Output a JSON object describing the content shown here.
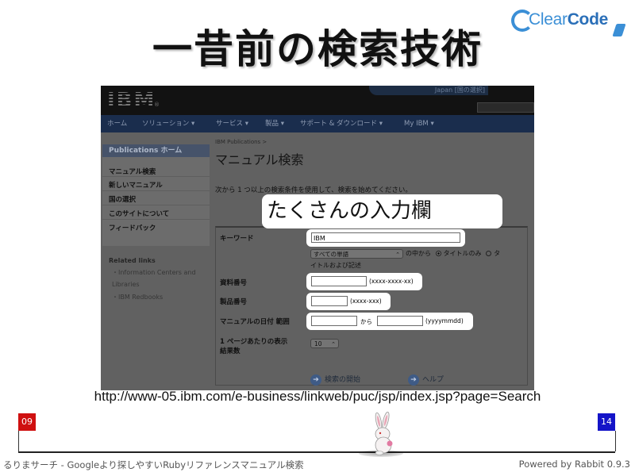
{
  "slide": {
    "title": "一昔前の検索技術",
    "callout": "たくさんの入力欄",
    "url": "http://www-05.ibm.com/e-business/linkweb/puc/jsp/index.jsp?page=Search"
  },
  "logo": {
    "prefix": "Clear",
    "suffix": "Code",
    "color": "#3b8fd6"
  },
  "screenshot": {
    "brand": "IBM",
    "region": "Japan [国の選択]",
    "nav": [
      "ホーム",
      "ソリューション ▾",
      "サービス ▾",
      "製品 ▾",
      "サポート & ダウンロード ▾",
      "My IBM ▾"
    ],
    "left_nav": {
      "header": "Publications ホーム",
      "items": [
        "マニュアル検索",
        "新しいマニュアル",
        "国の選択",
        "このサイトについて",
        "フィードバック"
      ]
    },
    "related": {
      "title": "Related links",
      "items": [
        "Information Centers and Libraries",
        "IBM Redbooks"
      ]
    },
    "breadcrumb": "IBM Publications >",
    "page_title": "マニュアル検索",
    "intro": "次から 1 つ以上の検索条件を使用して、検索を始めてください。",
    "form": {
      "keyword_label": "キーワード",
      "keyword_value": "IBM",
      "match_select": "すべての単語",
      "scope_label": "の中から",
      "scope_title": "タイトルのみ",
      "scope_title_and_desc": "タ",
      "scope_cont": "イトルおよび記述",
      "doc_number_label": "資料番号",
      "doc_number_hint": "(xxxx-xxxx-xx)",
      "product_number_label": "製品番号",
      "product_number_hint": "(xxxx-xxx)",
      "date_label": "マニュアルの日付 範囲",
      "date_from": "から",
      "date_hint": "(yyyymmdd)",
      "per_page_label_1": "1 ページあたりの表示",
      "per_page_label_2": "結果数",
      "per_page_value": "10",
      "search_button": "検索の開始",
      "help_button": "ヘルプ"
    }
  },
  "progress": {
    "start": "09",
    "end": "14"
  },
  "footer": {
    "left": "るりまサーチ - Googleより探しやすいRubyリファレンスマニュアル検索",
    "right": "Powered by Rabbit 0.9.3"
  }
}
